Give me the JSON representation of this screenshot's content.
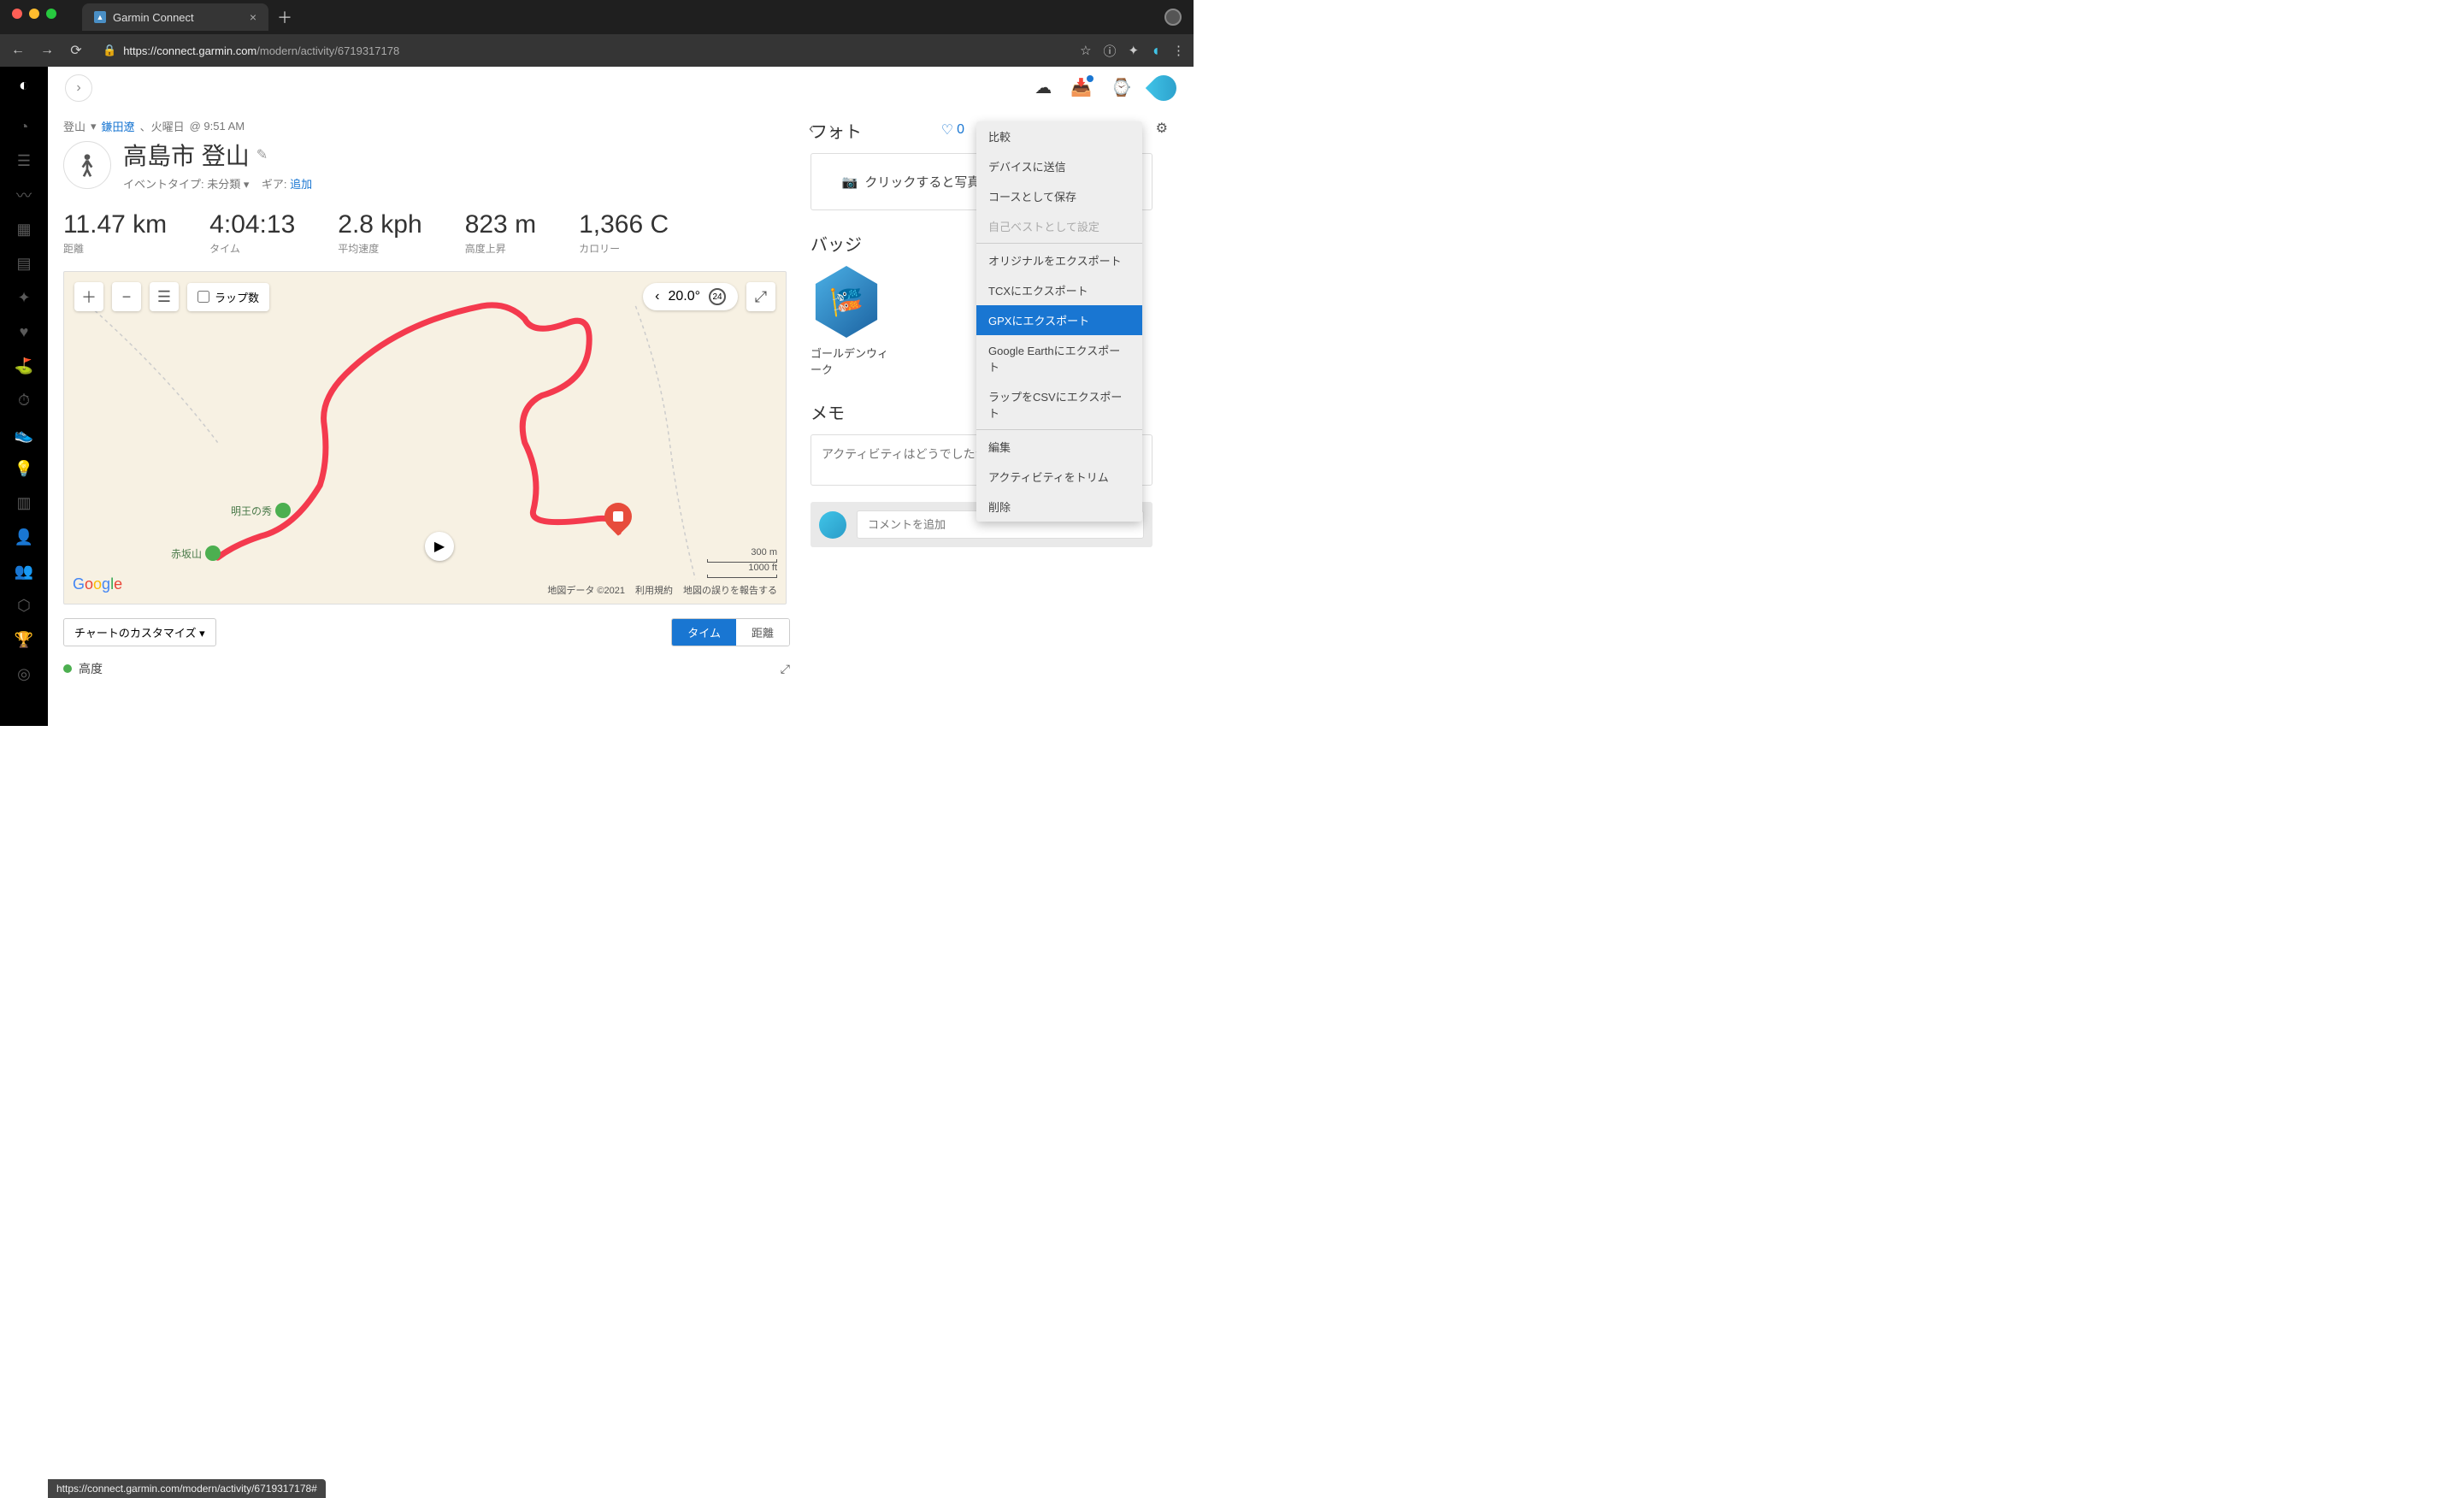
{
  "browser": {
    "tab_title": "Garmin Connect",
    "url_host": "https://connect.garmin.com",
    "url_path": "/modern/activity/6719317178",
    "status_url": "https://connect.garmin.com/modern/activity/6719317178#"
  },
  "breadcrumb": {
    "type": "登山",
    "user": "鎌田遼",
    "day": "、火曜日",
    "time": "@ 9:51 AM"
  },
  "title": "高島市 登山",
  "subline": {
    "event_label": "イベントタイプ:",
    "event_value": "未分類",
    "gear_label": "ギア:",
    "gear_link": "追加"
  },
  "fav_count": "0",
  "stats": [
    {
      "val": "11.47 km",
      "lbl": "距離"
    },
    {
      "val": "4:04:13",
      "lbl": "タイム"
    },
    {
      "val": "2.8 kph",
      "lbl": "平均速度"
    },
    {
      "val": "823 m",
      "lbl": "高度上昇"
    },
    {
      "val": "1,366 C",
      "lbl": "カロリー"
    }
  ],
  "map": {
    "laps_label": "ラップ数",
    "temp": "20.0°",
    "hour_badge": "24",
    "scale_m": "300 m",
    "scale_ft": "1000 ft",
    "copyright": "地図データ ©2021",
    "terms": "利用規約",
    "report": "地図の誤りを報告する",
    "label1": "明王の秀",
    "label2": "赤坂山"
  },
  "chart": {
    "customize": "チャートのカスタマイズ",
    "tab_time": "タイム",
    "tab_dist": "距離",
    "section": "高度"
  },
  "side": {
    "photo_h": "フォト",
    "photo_text": "クリックすると写真をアップロードできます",
    "badge_h": "バッジ",
    "badge_lbl": "ゴールデンウィーク",
    "memo_h": "メモ",
    "memo_ph": "アクティビティはどうでしたか?",
    "comment_ph": "コメントを追加"
  },
  "menu": [
    {
      "t": "比較",
      "k": "compare"
    },
    {
      "t": "デバイスに送信",
      "k": "send"
    },
    {
      "t": "コースとして保存",
      "k": "savecourse"
    },
    {
      "t": "自己ベストとして設定",
      "k": "pb",
      "dis": true
    },
    {
      "sep": true
    },
    {
      "t": "オリジナルをエクスポート",
      "k": "exorig"
    },
    {
      "t": "TCXにエクスポート",
      "k": "extcx"
    },
    {
      "t": "GPXにエクスポート",
      "k": "exgpx",
      "sel": true
    },
    {
      "t": "Google Earthにエクスポート",
      "k": "exge"
    },
    {
      "t": "ラップをCSVにエクスポート",
      "k": "excsv"
    },
    {
      "sep": true
    },
    {
      "t": "編集",
      "k": "edit"
    },
    {
      "t": "アクティビティをトリム",
      "k": "trim"
    },
    {
      "t": "削除",
      "k": "del"
    }
  ]
}
